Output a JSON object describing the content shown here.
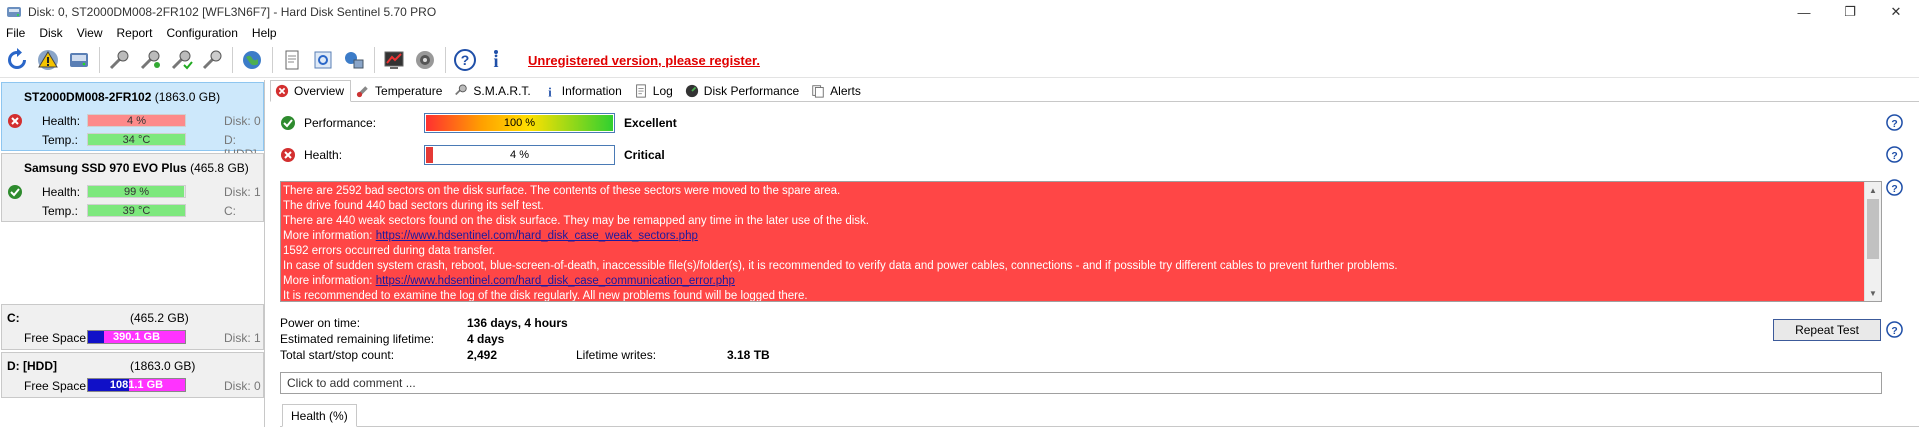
{
  "window": {
    "title": "Disk: 0, ST2000DM008-2FR102 [WFL3N6F7]  -  Hard Disk Sentinel 5.70 PRO",
    "controls": {
      "minimize": "—",
      "restore": "❐",
      "close": "✕"
    }
  },
  "menu": [
    "File",
    "Disk",
    "View",
    "Report",
    "Configuration",
    "Help"
  ],
  "toolbar": {
    "unregistered_text": "Unregistered version, please register."
  },
  "disks": [
    {
      "name": "ST2000DM008-2FR102",
      "size": "(1863.0 GB)",
      "status": "critical",
      "health_label": "Health:",
      "health_value": "4 %",
      "health_pct": 4,
      "health_color": "#ff6a6a",
      "temp_label": "Temp.:",
      "temp_value": "34 °C",
      "disk_no": "Disk: 0",
      "drive": "D: [HDD]"
    },
    {
      "name": "Samsung SSD 970 EVO Plus",
      "size": "(465.8 GB)",
      "status": "ok",
      "health_label": "Health:",
      "health_value": "99 %",
      "health_pct": 99,
      "health_color": "#7de87d",
      "temp_label": "Temp.:",
      "temp_value": "39 °C",
      "disk_no": "Disk: 1",
      "drive": "C:"
    }
  ],
  "drives": [
    {
      "letter": "C:",
      "size": "(465.2 GB)",
      "free_label": "Free Space",
      "free_value": "390.1 GB",
      "free_fraction": 0.84,
      "disk": "Disk: 1"
    },
    {
      "letter": "D: [HDD]",
      "size": "(1863.0 GB)",
      "free_label": "Free Space",
      "free_value": "1081.1 GB",
      "free_fraction": 0.58,
      "disk": "Disk: 0"
    }
  ],
  "tabs": [
    "Overview",
    "Temperature",
    "S.M.A.R.T.",
    "Information",
    "Log",
    "Disk Performance",
    "Alerts"
  ],
  "overview": {
    "performance": {
      "label": "Performance:",
      "value": "100 %",
      "pct": 100,
      "verdict": "Excellent"
    },
    "health": {
      "label": "Health:",
      "value": "4 %",
      "pct": 4,
      "verdict": "Critical"
    },
    "messages": [
      "There are 2592 bad sectors on the disk surface. The contents of these sectors were moved to the spare area.",
      "The drive found 440 bad sectors during its self test.",
      "There are 440 weak sectors found on the disk surface. They may be remapped any time in the later use of the disk."
    ],
    "more_info_label": "More information: ",
    "link1": "https://www.hdsentinel.com/hard_disk_case_weak_sectors.php",
    "messages2": [
      "1592 errors occurred during data transfer.",
      "In case of sudden system crash, reboot, blue-screen-of-death, inaccessible file(s)/folder(s), it is recommended to verify data and power cables, connections - and if possible try different cables to prevent further problems."
    ],
    "link2": "https://www.hdsentinel.com/hard_disk_case_communication_error.php",
    "messages3": [
      "It is recommended to examine the log of the disk regularly. All new problems found will be logged there."
    ],
    "power_on_label": "Power on time:",
    "power_on_value": "136 days, 4 hours",
    "remaining_label": "Estimated remaining lifetime:",
    "remaining_value": "4 days",
    "startstop_label": "Total start/stop count:",
    "startstop_value": "2,492",
    "writes_label": "Lifetime writes:",
    "writes_value": "3.18 TB",
    "repeat_button": "Repeat Test",
    "comment_placeholder": "Click to add comment ...",
    "subtab": "Health (%)"
  }
}
